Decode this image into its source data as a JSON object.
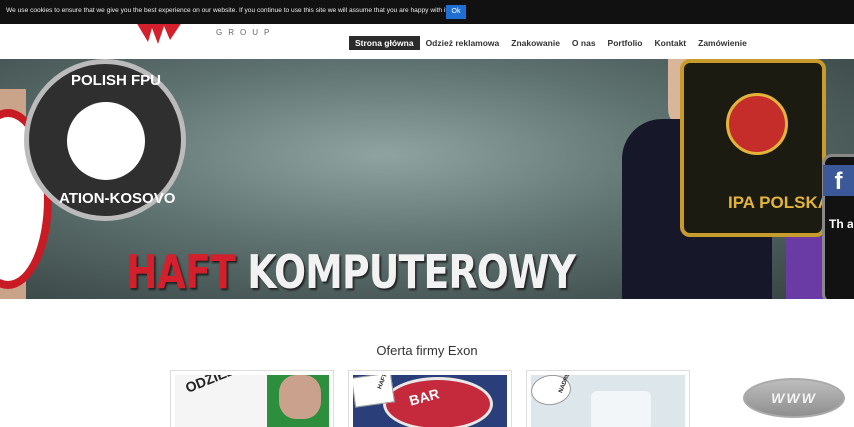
{
  "cookie_bar": {
    "message": "We use cookies to ensure that we give you the best experience on our website. If you continue to use this site we will assume that you are happy with it.",
    "ok_label": "Ok"
  },
  "header": {
    "logo_sub": "GROUP",
    "nav": [
      {
        "label": "Strona główna",
        "active": true
      },
      {
        "label": "Odzież reklamowa"
      },
      {
        "label": "Znakowanie"
      },
      {
        "label": "O nas"
      },
      {
        "label": "Portfolio"
      },
      {
        "label": "Kontakt"
      },
      {
        "label": "Zamówienie"
      }
    ]
  },
  "hero": {
    "title_red": "HAFT",
    "title_white": "KOMPUTEROWY",
    "patch_top_text": "POLISH FPU",
    "patch_bottom_text": "ATION-KOSOVO",
    "ipa_text": "IPA POLSKA",
    "right_patch_text": "Th am"
  },
  "social": {
    "facebook_glyph": "f"
  },
  "offer": {
    "title": "Oferta firmy Exon",
    "cards": [
      {
        "text": "ODZIEŻ REKLAMOWA"
      },
      {
        "tag": "HAFT",
        "text": "BAR"
      },
      {
        "tag": "NADRUK"
      }
    ]
  },
  "www_badge": {
    "label": "WWW"
  },
  "colors": {
    "accent_red": "#d3202c",
    "nav_active": "#2b2b2b",
    "cookie_ok": "#1e6fd1",
    "facebook": "#3b5998"
  }
}
